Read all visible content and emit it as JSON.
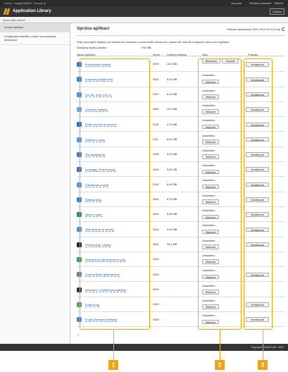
{
  "topbar": {
    "crumbs": "Canon · imageRUNNER · Remote UI",
    "portal": "Na portál",
    "user_label": "Přihlášení uživatelé:",
    "user_id": "7654321",
    "logout": "Odhlásit"
  },
  "app": {
    "title": "Application Library"
  },
  "subheader": "Správa dialo zařízení",
  "sidebar": {
    "items": [
      "Správa aplikací",
      "Konfigurace tlačítek a karet na domovské obrazovce"
    ]
  },
  "main": {
    "title": "Správa aplikací",
    "last_update_label": "Poslední aktualizace 23/01 2022 04:34:34 dp",
    "note": "Když povolujete aplikaci, její tlačítko se nezobrazí na domovské obrazovce, pokud zde nebude k dispozici místo pro registraci.",
    "space_label": "Dostupný služný prostor:",
    "space_value": "7.54 MB",
    "to_top": "⌃",
    "columns": [
      "Název aplikace",
      "Verze",
      "Celková velikost",
      "Stav",
      "Pravidla"
    ]
  },
  "apps": [
    {
      "name": "Pohotovostní snímek",
      "version": "0200",
      "size": "13.6 MB",
      "state": [
        "Blokováno",
        "Umožnit"
      ],
      "init": "Inicializovat",
      "color": "#3a7bd5"
    },
    {
      "name": "Kopírovat (dvajitá text)",
      "version": "0302",
      "size": "6.51 MB",
      "state": [
        "Umožněno",
        "Blokovat"
      ],
      "init": "Inicializovat",
      "color": "#3b82c4"
    },
    {
      "name": "Od. fax, ne pl. mís. sr.",
      "version": "0107",
      "size": "6.44 MB",
      "state": [
        "Umožněno",
        "Blokovat"
      ],
      "init": "Inicializovat",
      "color": "#4a90d9"
    },
    {
      "name": "Cloudové aplikace",
      "version": "3650",
      "size": "12.9 MB",
      "state": [
        "Umožněno",
        "Blokovat"
      ],
      "init": "Inicializovat",
      "color": "#6aa9e0"
    },
    {
      "name": "Pohot. snímek ze serveru",
      "version": "0110",
      "size": "4.72 MB",
      "state": [
        "Umožněno",
        "Blokovat"
      ],
      "init": "Inicializovat",
      "color": "#2f6fb0"
    },
    {
      "name": "Šablona e-mailu",
      "version": "0111",
      "size": "6.81 MB",
      "state": [
        "Umožněno",
        "Blokovat"
      ],
      "init": "Inicializovat",
      "color": "#5a8fc9"
    },
    {
      "name": "Tisk faxů/klienta",
      "version": "0108",
      "size": "5.92 MB",
      "state": [
        "Umožněno",
        "Blokovat"
      ],
      "init": "Inicializovat",
      "color": "#4479bb"
    },
    {
      "name": "Language (Změnit jazyk)",
      "version": "0104",
      "size": "5.52 MB",
      "state": [
        "Umožněno",
        "Blokovat"
      ],
      "init": "Inicializovat",
      "color": "#3d6fa8"
    },
    {
      "name": "Odhlasovat a uložit",
      "version": "0110",
      "size": "6.44 MB",
      "state": [
        "Umožněno",
        "Blokovat"
      ],
      "init": "Inicializovat",
      "color": "#5d92cc"
    },
    {
      "name": "Šablona tisku",
      "version": "0406",
      "size": "6.75 MB",
      "state": [
        "Umožněno",
        "Blokovat"
      ],
      "init": "Inicializovat",
      "color": "#3b82c4"
    },
    {
      "name": "Název a akce",
      "version": "0209",
      "size": "6.95 MB",
      "state": [
        "Umožněno",
        "Blokovat"
      ],
      "init": "Inicializovat",
      "color": "#2e8b57"
    },
    {
      "name": "Tisk souboru ze serveru",
      "version": "0114",
      "size": "9.44 MB",
      "state": [
        "Umožněno",
        "Blokovat"
      ],
      "init": "Inicializovat",
      "color": "#4a90d9"
    },
    {
      "name": "Příručka App. Library",
      "version": "0601",
      "size": "34.4 MB",
      "state": [
        "Umožněno",
        "Blokovat"
      ],
      "init": "Inicializovat",
      "color": "#222222"
    },
    {
      "name": "Skenovat do předvoleného místa",
      "version": "0100",
      "size": "-",
      "state": [
        "Umožněno",
        "Blokovat"
      ],
      "init": "",
      "color": "#3a9a4a"
    },
    {
      "name": "Kopie průkazu (jednoduché)",
      "version": "0100",
      "size": "-",
      "state": [
        "Umožněno",
        "Blokovat"
      ],
      "init": "Inicializovat",
      "color": "#6b7c8f"
    },
    {
      "name": "Informace o spotřebním materiálu",
      "version": "0100",
      "size": "-",
      "state": [
        "Umožněno",
        "Blokovat"
      ],
      "init": "",
      "color": "#333333"
    },
    {
      "name": "Kopie (Eco)",
      "version": "0100",
      "size": "-",
      "state": [
        "Umožněno",
        "Blokovat"
      ],
      "init": "Inicializovat",
      "color": "#5aa05a"
    },
    {
      "name": "Kopie (Omezení prolinání)",
      "version": "0100",
      "size": "-",
      "state": [
        "Umožněno",
        "Blokovat"
      ],
      "init": "Inicializovat",
      "color": "#4f86c6"
    }
  ],
  "footer": "Copyright CANON INC. 2022",
  "callouts": [
    "1",
    "2",
    "3"
  ]
}
